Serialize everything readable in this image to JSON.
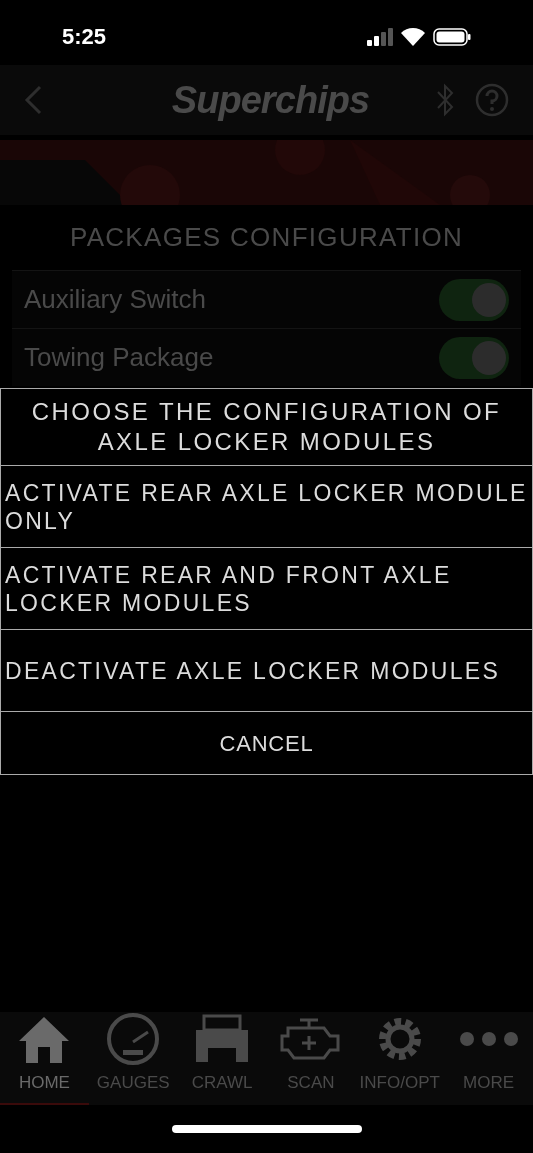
{
  "status_bar": {
    "time": "5:25"
  },
  "header": {
    "logo": "Superchips"
  },
  "section_title": "PACKAGES CONFIGURATION",
  "packages": [
    {
      "label": "Auxiliary Switch",
      "on": true
    },
    {
      "label": "Towing Package",
      "on": true
    }
  ],
  "dialog": {
    "title": "CHOOSE THE CONFIGURATION OF AXLE LOCKER MODULES",
    "options": [
      "ACTIVATE REAR AXLE LOCKER MODULE ONLY",
      "ACTIVATE REAR AND FRONT AXLE LOCKER MODULES",
      "DEACTIVATE AXLE LOCKER MODULES"
    ],
    "cancel": "CANCEL"
  },
  "tabs": [
    {
      "label": "HOME",
      "kind": "home",
      "selected": true
    },
    {
      "label": "GAUGES",
      "kind": "gauges",
      "selected": false
    },
    {
      "label": "CRAWL",
      "kind": "crawl",
      "selected": false
    },
    {
      "label": "SCAN",
      "kind": "scan",
      "selected": false
    },
    {
      "label": "INFO/OPT",
      "kind": "settings",
      "selected": false
    },
    {
      "label": "MORE",
      "kind": "more",
      "selected": false
    }
  ]
}
